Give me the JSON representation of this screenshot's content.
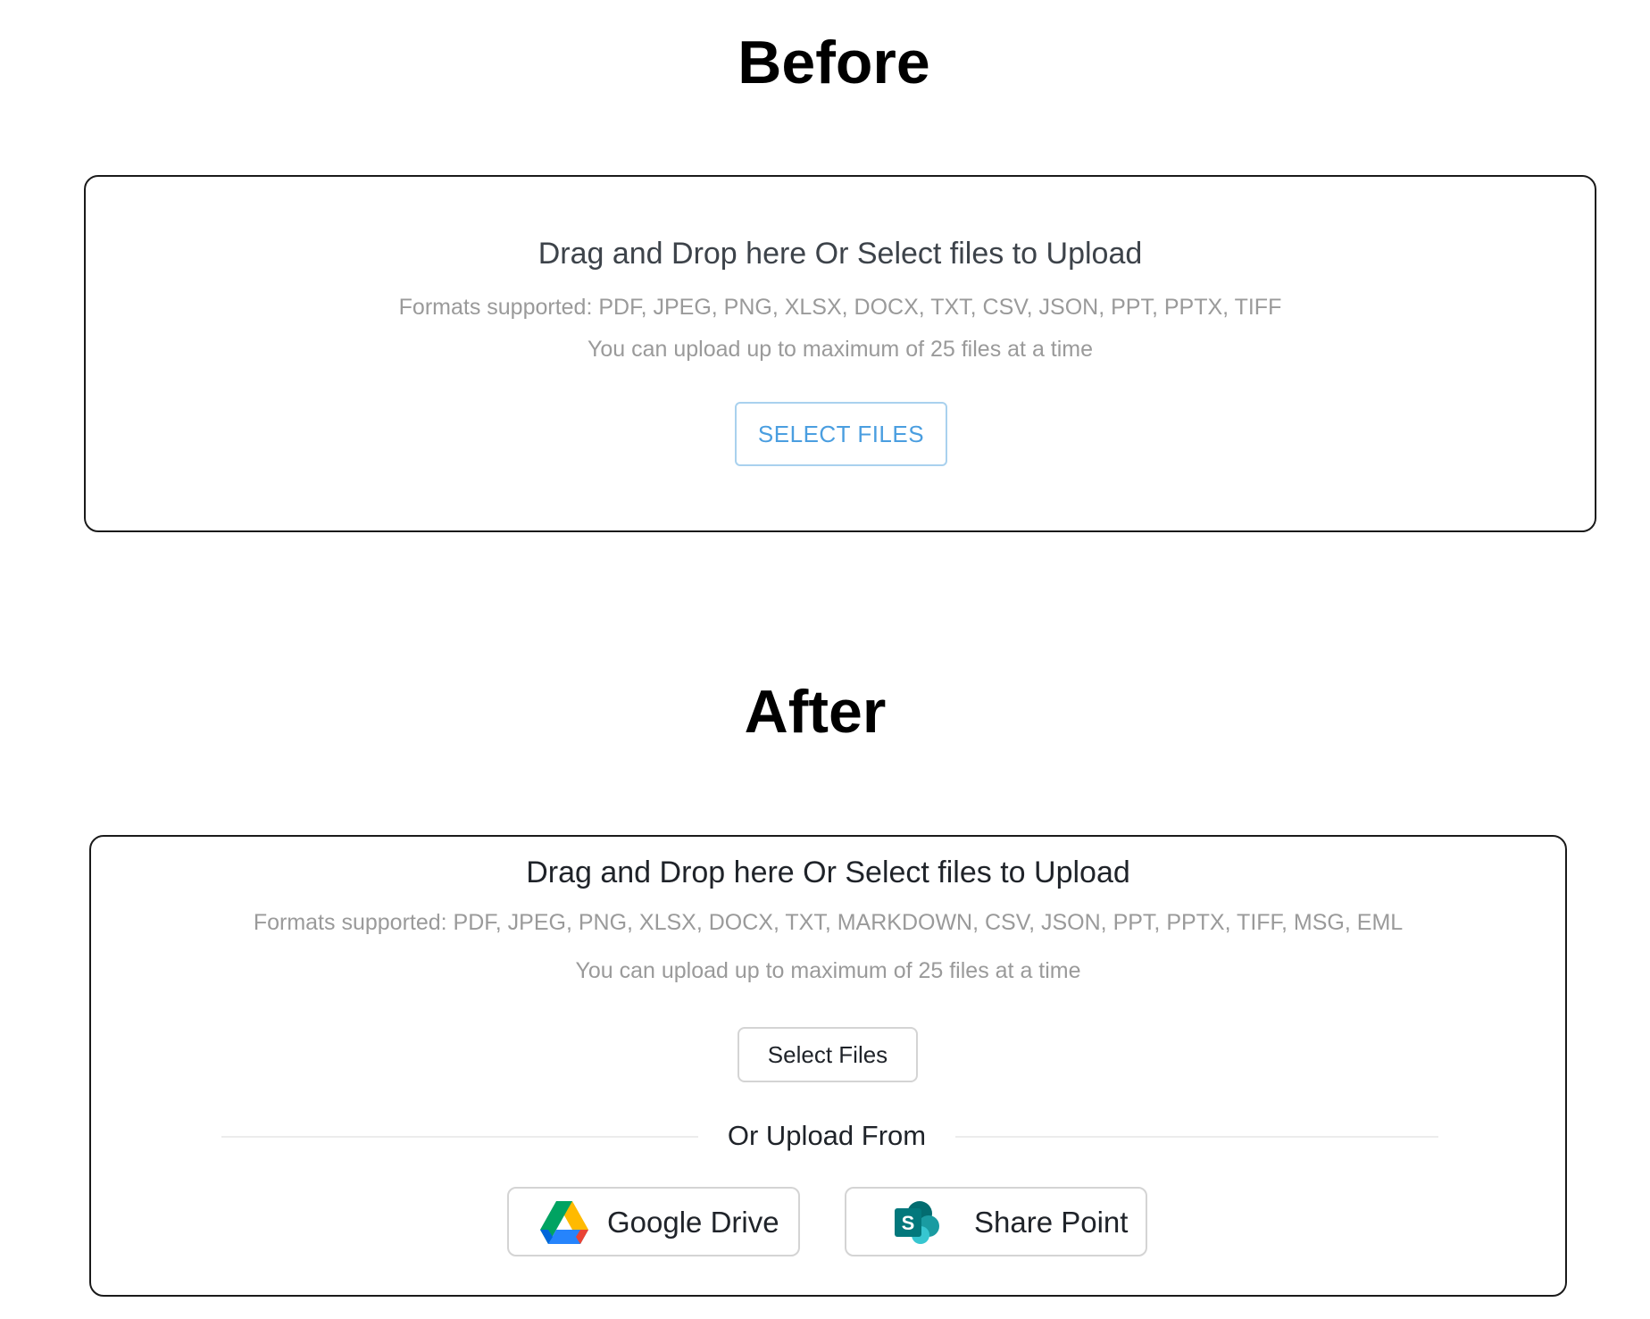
{
  "before": {
    "title": "Before",
    "headline": "Drag and Drop here Or Select files to Upload",
    "formats": "Formats supported: PDF, JPEG, PNG, XLSX, DOCX, TXT, CSV, JSON, PPT, PPTX, TIFF",
    "limit": "You can upload up to maximum of 25 files at a time",
    "select_button": "SELECT FILES"
  },
  "after": {
    "title": "After",
    "headline": "Drag and Drop here Or Select files to Upload",
    "formats": "Formats supported: PDF, JPEG, PNG, XLSX, DOCX, TXT, MARKDOWN, CSV, JSON, PPT, PPTX, TIFF, MSG, EML",
    "limit": "You can upload up to maximum of 25 files at a time",
    "select_button": "Select Files",
    "divider_label": "Or Upload From",
    "providers": [
      {
        "label": "Google Drive",
        "icon": "google-drive-icon"
      },
      {
        "label": "Share Point",
        "icon": "sharepoint-icon"
      }
    ]
  },
  "colors": {
    "before_button_text": "#4a9ee0",
    "before_button_border": "#a9d1ee",
    "muted_text": "#9a9a9a",
    "box_border": "#1a1a1a"
  }
}
